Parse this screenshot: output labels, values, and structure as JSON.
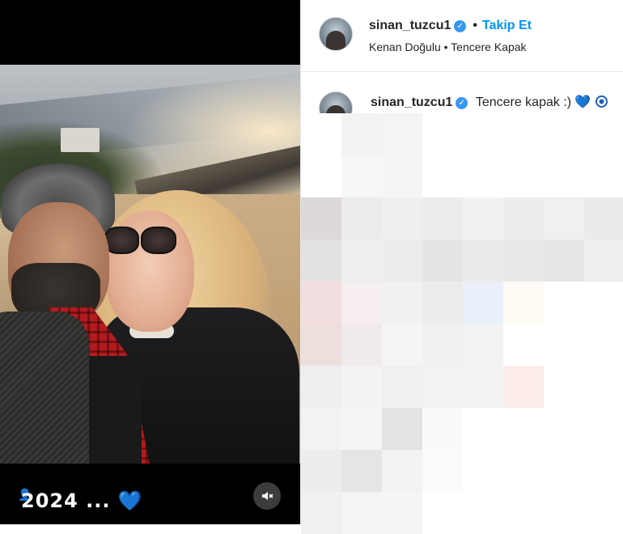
{
  "post": {
    "caption_text": "2024 ...",
    "caption_emoji": "💙",
    "mute_icon": "speaker-muted-icon"
  },
  "header": {
    "username": "sinan_tuzcu1",
    "follow_label": "Takip Et",
    "audio_line": "Kenan Doğulu • Tencere Kapak"
  },
  "comment": {
    "username": "sinan_tuzcu1",
    "text": "Tencere kapak :)",
    "emoji_heart": "💙",
    "emoji_eye": "🧿"
  },
  "colors": {
    "verified": "#3897f0",
    "follow": "#0095f6",
    "text": "#262626"
  }
}
